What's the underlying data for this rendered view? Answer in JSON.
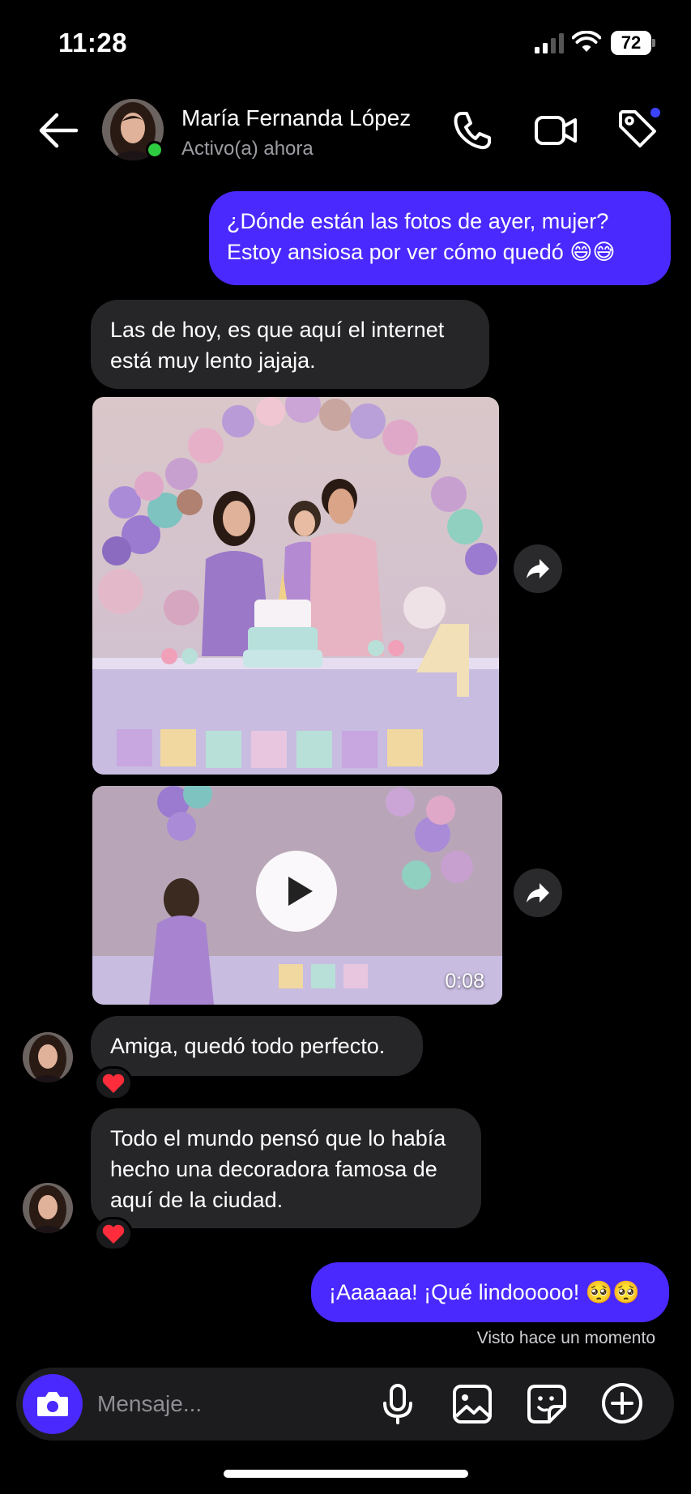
{
  "status_bar": {
    "time": "11:28",
    "battery": "72"
  },
  "header": {
    "contact_name": "María Fernanda López",
    "contact_status": "Activo(a) ahora",
    "icons": [
      "back-arrow-icon",
      "phone-icon",
      "video-camera-icon",
      "tag-icon"
    ]
  },
  "messages": [
    {
      "direction": "outgoing",
      "text": "¿Dónde están las fotos de ayer, mujer? Estoy ansiosa por ver cómo quedó 😄😅"
    },
    {
      "direction": "incoming",
      "text": "Las de hoy, es que aquí el internet está muy lento jajaja."
    },
    {
      "direction": "incoming",
      "type": "photo"
    },
    {
      "direction": "incoming",
      "type": "video",
      "duration": "0:08"
    },
    {
      "direction": "incoming",
      "text": "Amiga, quedó todo perfecto.",
      "reaction": "❤️"
    },
    {
      "direction": "incoming",
      "text": "Todo el mundo pensó que lo había hecho una decoradora famosa de aquí de la ciudad.",
      "reaction": "❤️"
    },
    {
      "direction": "outgoing",
      "text": "¡Aaaaaa! ¡Qué lindooooo! 🥺🥺"
    }
  ],
  "seen_status": "Visto hace un momento",
  "composer": {
    "placeholder": "Mensaje...",
    "icons": [
      "camera-icon",
      "microphone-icon",
      "gallery-icon",
      "sticker-icon",
      "plus-icon"
    ]
  },
  "colors": {
    "outgoing_bubble": "#4a29ff",
    "incoming_bubble": "#262628",
    "online": "#2ecc40",
    "background": "#000000"
  }
}
